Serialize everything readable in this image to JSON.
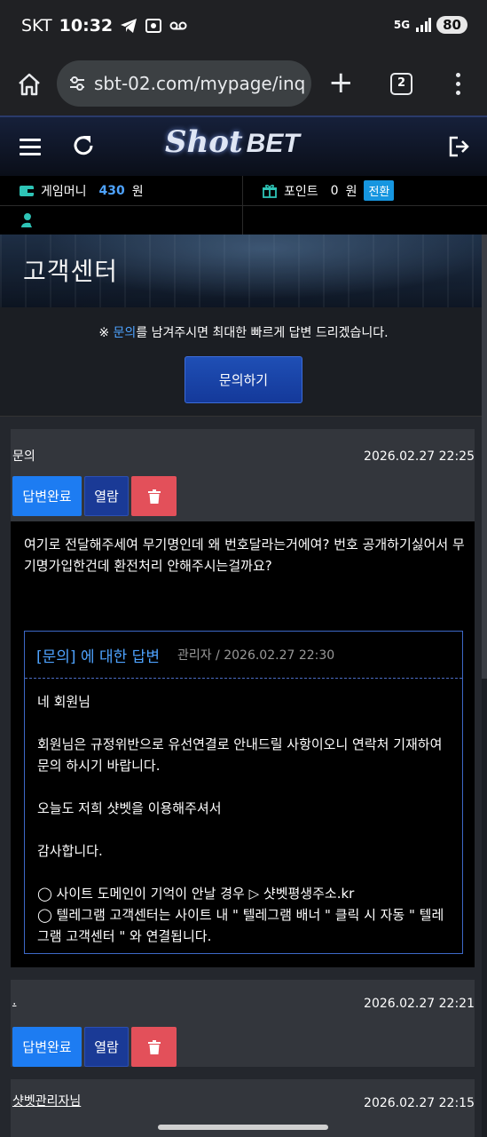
{
  "status_bar": {
    "carrier": "SKT",
    "time": "10:32",
    "network": "5G",
    "battery": "80"
  },
  "browser": {
    "url": "sbt-02.com/mypage/inq",
    "tab_count": "2"
  },
  "site": {
    "logo_shot": "Shot",
    "logo_bet": "BET"
  },
  "account": {
    "game_money_label": "게임머니",
    "game_money_value": "430",
    "game_money_unit": "원",
    "points_label": "포인트",
    "points_value": "0",
    "points_unit": "원",
    "convert_label": "전환"
  },
  "banner": {
    "title": "고객센터"
  },
  "notice": {
    "prefix": "※ ",
    "highlight": "문의",
    "suffix": "를 남겨주시면 최대한 빠르게 답변 드리겠습니다.",
    "ask_button": "문의하기"
  },
  "inquiries": [
    {
      "title": "문의",
      "date": "2026.02.27 22:25",
      "status_label": "답변완료",
      "view_label": "열람",
      "question": "여기로 전달해주세여 무기명인데 왜 번호달라는거에여? 번호 공개하기싫어서 무기명가입한건데 환전처리 안해주시는걸까요?",
      "answer": {
        "title": "[문의] 에 대한 답변",
        "meta": "관리자 / 2026.02.27 22:30",
        "lines": [
          "네 회원님",
          "회원님은 규정위반으로 유선연결로 안내드릴 사항이오니 연락처 기재하여 문의 하시기 바랍니다.",
          "오늘도 저희 샷벳을 이용해주셔서",
          "감사합니다.",
          "◯ 사이트 도메인이 기억이 안날 경우 ▷ 샷벳평생주소.kr",
          "◯ 텔레그램 고객센터는 사이트 내 \" 텔레그램 배너 \" 클릭 시 자동 \" 텔레그램 고객센터 \" 와 연결됩니다."
        ]
      }
    },
    {
      "title": ".",
      "date": "2026.02.27 22:21",
      "status_label": "답변완료",
      "view_label": "열람"
    },
    {
      "title": "샷벳관리자님",
      "date": "2026.02.27 22:15"
    }
  ],
  "colors": {
    "accent": "#4ea3ff",
    "primary_button": "#1d7cf2",
    "delete_button": "#e3505a",
    "view_button": "#1a3a96"
  }
}
